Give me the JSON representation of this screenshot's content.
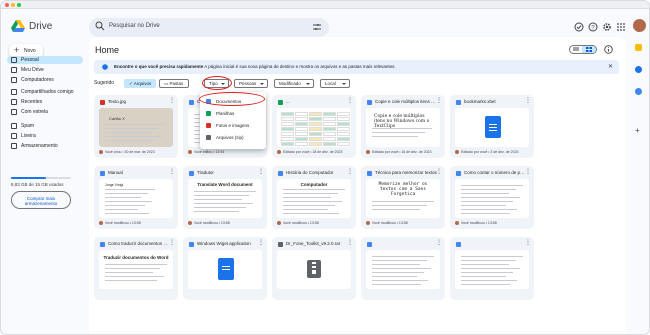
{
  "app": {
    "brand": "Drive",
    "search_placeholder": "Pesquisar no Drive"
  },
  "sidebar": {
    "new_label": "Novo",
    "items": [
      {
        "label": "Pessoal",
        "icon": "drive-icon",
        "active": true
      },
      {
        "label": "Meu Drive",
        "icon": "folder-icon"
      },
      {
        "label": "Computadores",
        "icon": "computer-icon"
      },
      {
        "label": "Compartilhados comigo",
        "icon": "people-icon"
      },
      {
        "label": "Recentes",
        "icon": "clock-icon"
      },
      {
        "label": "Com estrela",
        "icon": "star-icon"
      },
      {
        "label": "Spam",
        "icon": "spam-icon"
      },
      {
        "label": "Lixeira",
        "icon": "trash-icon"
      },
      {
        "label": "Armazenamento",
        "icon": "cloud-icon"
      }
    ],
    "storage_text": "8,83 GB de 15 GB usados",
    "storage_fraction": 0.59,
    "buy_label": "Comprar mais armazenamento"
  },
  "main": {
    "title": "Home",
    "banner_bold": "Encontre o que você precisa rapidamente",
    "banner_text": "A página inicial é sua nova página de destino e mostra os arquivos e as pastas mais relevantes.",
    "suggested_label": "Sugerido",
    "chips": [
      "Arquivos",
      "Pastas",
      "Tipo",
      "Pessoas",
      "Modificado",
      "Local"
    ],
    "type_menu": [
      {
        "label": "Documentos",
        "color": "#4285f4"
      },
      {
        "label": "Planilhas",
        "color": "#0f9d58"
      },
      {
        "label": "Fotos e imagens",
        "color": "#d93025"
      },
      {
        "label": "Arquivos (zip)",
        "color": "#5f6368"
      }
    ],
    "cards": [
      {
        "name": "Texto.jpg",
        "meta": "Você criou • 30 de mar. de 2023",
        "icon_color": "#d93025"
      },
      {
        "name": "Crie ... online livr...",
        "meta": "Você editou • 13:54",
        "icon_color": "#4285f4"
      },
      {
        "name": "...",
        "meta": "Editado por você • 18 de dez. de 2023",
        "icon_color": "#0f9d58"
      },
      {
        "name": "Copie e cole múltiplos itens no Wi...",
        "meta": "Editado por você • 16 de dez. de 2023",
        "icon_color": "#4285f4"
      },
      {
        "name": "bookmarks.xbel",
        "meta": "Editado por você • 3 de dez. de 2023",
        "icon_color": "#4285f4"
      },
      {
        "name": "Manual",
        "meta": "Você modificou • 13:58",
        "icon_color": "#4285f4"
      },
      {
        "name": "Tradutor",
        "meta": "Você modificou • 13:58",
        "icon_color": "#4285f4"
      },
      {
        "name": "História do Computador",
        "meta": "Você modificou • 13:58",
        "icon_color": "#4285f4"
      },
      {
        "name": "Técnica para memorizar textos",
        "meta": "Você modificou • 13:58",
        "icon_color": "#4285f4"
      },
      {
        "name": "Como contar o número de palavr...",
        "meta": "Você modificou • 13:58",
        "icon_color": "#4285f4"
      },
      {
        "name": "Como traduzir documentos do W...",
        "meta": "",
        "icon_color": "#4285f4"
      },
      {
        "name": "Windows Wiget.application",
        "meta": "",
        "icon_color": "#4285f4"
      },
      {
        "name": "Dr_Fone_Toolkit_v9.2.0.rar",
        "meta": "",
        "icon_color": "#5f6368"
      },
      {
        "name": "",
        "meta": "",
        "icon_color": "#4285f4"
      },
      {
        "name": "",
        "meta": "",
        "icon_color": "#4285f4"
      }
    ],
    "thumb_text": {
      "carta": "Cartão X",
      "copie": "Copie e cole múltiplos itens no Windows com o TextClips",
      "translate": "Translate Word document",
      "computador": "Computador",
      "memorize": "Memorize melhor os textos com a Sans Forgetica",
      "traduzir": "Traduzir documentos do Word",
      "manual": "Jorge Vinigi"
    }
  }
}
